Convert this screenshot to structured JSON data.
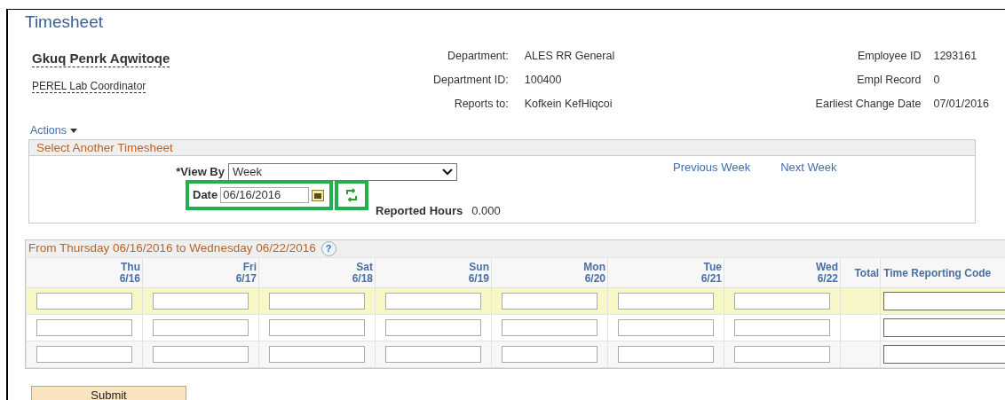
{
  "page_title": "Timesheet",
  "employee": {
    "name": "Gkuq Penrk Aqwitoqe",
    "job_title": "PEREL Lab Coordinator"
  },
  "details_middle": [
    {
      "label": "Department:",
      "value": "ALES RR General"
    },
    {
      "label": "Department ID:",
      "value": "100400"
    },
    {
      "label": "Reports to:",
      "value": "Kofkein KefHiqcoi"
    }
  ],
  "details_right": [
    {
      "label": "Employee ID",
      "value": "1293161"
    },
    {
      "label": "Empl Record",
      "value": "0"
    },
    {
      "label": "Earliest Change Date",
      "value": "07/01/2016"
    }
  ],
  "actions_menu": "Actions",
  "select_panel": {
    "title": "Select Another Timesheet",
    "view_by_label": "*View By",
    "view_by_value": "Week",
    "date_label": "Date",
    "date_value": "06/16/2016",
    "date_highlighted": true,
    "refresh_highlighted": true,
    "links": [
      "Previous Week",
      "Next Week"
    ],
    "reported_hours_label": "Reported Hours",
    "reported_hours_value": "0.000"
  },
  "grid": {
    "title": "From Thursday 06/16/2016 to Wednesday 06/22/2016",
    "help": "?",
    "day_columns": [
      {
        "day": "Thu",
        "date": "6/16"
      },
      {
        "day": "Fri",
        "date": "6/17"
      },
      {
        "day": "Sat",
        "date": "6/18"
      },
      {
        "day": "Sun",
        "date": "6/19"
      },
      {
        "day": "Mon",
        "date": "6/20"
      },
      {
        "day": "Tue",
        "date": "6/21"
      },
      {
        "day": "Wed",
        "date": "6/22"
      }
    ],
    "total_column": "Total",
    "code_column": "Time Reporting Code",
    "rows": [
      {
        "selected": true
      },
      {
        "selected": false
      },
      {
        "selected": false
      }
    ]
  },
  "submit_button": "Submit"
}
